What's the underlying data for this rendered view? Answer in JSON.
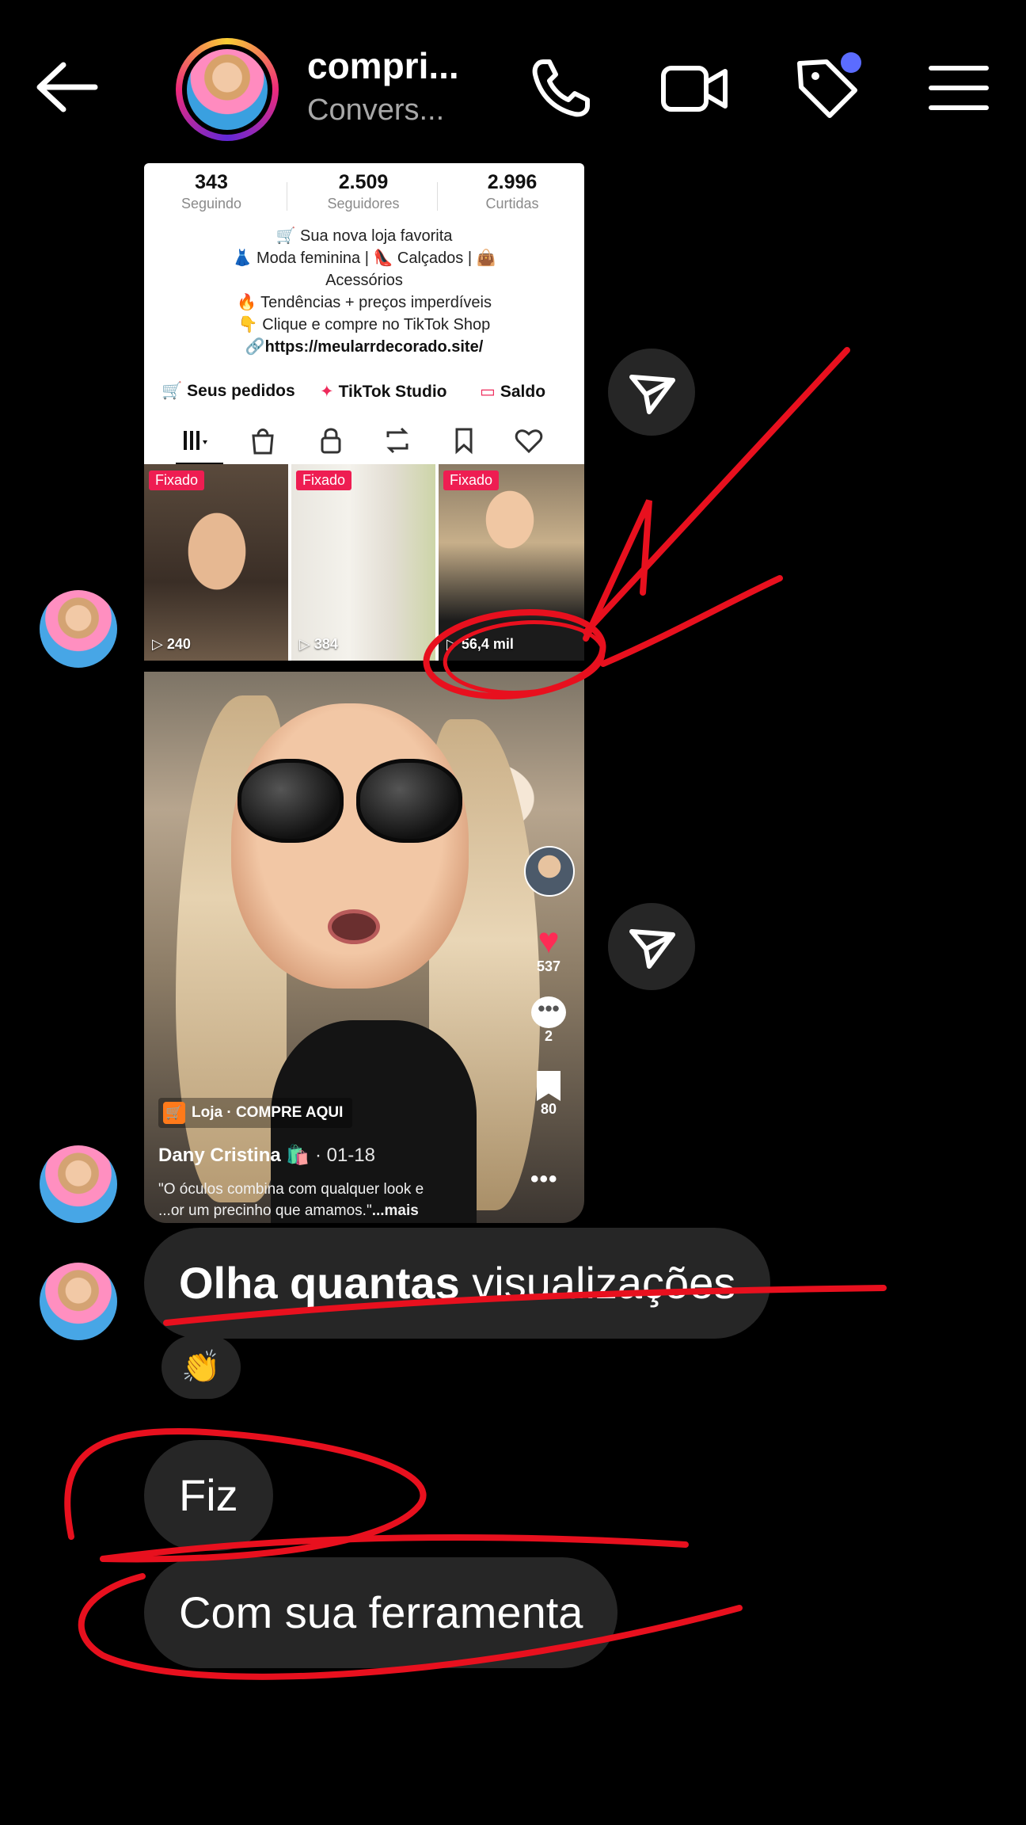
{
  "header": {
    "title": "compri...",
    "subtitle": "Convers..."
  },
  "profile_screenshot": {
    "stats": [
      {
        "value": "343",
        "label": "Seguindo"
      },
      {
        "value": "2.509",
        "label": "Seguidores"
      },
      {
        "value": "2.996",
        "label": "Curtidas"
      }
    ],
    "bio": [
      "🛒 Sua nova loja favorita",
      "👗 Moda feminina | 👠 Calçados | 👜",
      "Acessórios",
      "🔥 Tendências + preços imperdíveis",
      "👇 Clique e compre no TikTok Shop"
    ],
    "link": "https://meularrdecorado.site/",
    "quick_links": [
      "Seus pedidos",
      "TikTok Studio",
      "Saldo"
    ],
    "thumbnails": [
      {
        "badge": "Fixado",
        "views": "240"
      },
      {
        "badge": "Fixado",
        "views": "384"
      },
      {
        "badge": "Fixado",
        "views": "56,4 mil"
      }
    ]
  },
  "video_screenshot": {
    "likes": "537",
    "comments": "2",
    "saves": "80",
    "shop_tag": "Loja · COMPRE AQUI",
    "author": "Dany Cristina",
    "date": "· 01-18",
    "caption_line1": "\"O óculos combina com qualquer look e",
    "caption_line2": "...or um precinho que amamos.\"",
    "caption_more": "...mais"
  },
  "messages": [
    {
      "bold": "Olha quantas",
      "regular": " visualizações"
    },
    {
      "text": "Fiz"
    },
    {
      "text": "Com sua ferramenta"
    }
  ],
  "reaction": "👏",
  "colors": {
    "background": "#000000",
    "bubble": "#262626",
    "accent_dot": "#5b6cff",
    "tiktok_red": "#ee1d52",
    "annotation_red": "#e8101e"
  },
  "icons": {
    "back": "arrow-left",
    "call": "phone",
    "video": "video-camera",
    "tag": "tag",
    "menu": "hamburger",
    "share": "send"
  }
}
